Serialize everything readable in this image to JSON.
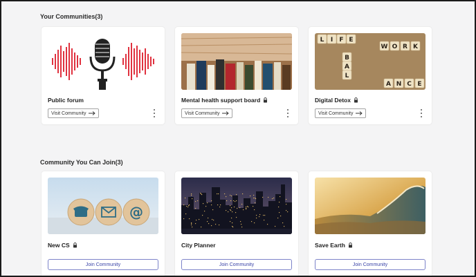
{
  "your_communities": {
    "heading": "Your Communities(3)",
    "cards": [
      {
        "name": "Public forum",
        "locked": false,
        "image": "microphone-soundwave",
        "button": "Visit Community"
      },
      {
        "name": "Mental health support board",
        "locked": true,
        "image": "books-on-shelf",
        "button": "Visit Community"
      },
      {
        "name": "Digital Detox",
        "locked": true,
        "image": "scrabble-tiles-life-work-balance",
        "button": "Visit Community",
        "tile_words": [
          "LIFE",
          "WORK",
          "BAL",
          "ANCE"
        ]
      }
    ]
  },
  "join_communities": {
    "heading": "Community You Can Join(3)",
    "cards": [
      {
        "name": "New CS",
        "locked": true,
        "image": "contact-icons-wooden-discs",
        "button": "Join Community"
      },
      {
        "name": "City Planner",
        "locked": false,
        "image": "city-skyline-night",
        "button": "Join Community"
      },
      {
        "name": "Save Earth",
        "locked": true,
        "image": "ocean-wave-sunset",
        "button": "Join Community"
      }
    ]
  },
  "colors": {
    "accent": "#3a44a8",
    "join_border": "#7c83c9",
    "soundwave": "#e0323f",
    "page_bg": "#f4f4f5"
  }
}
